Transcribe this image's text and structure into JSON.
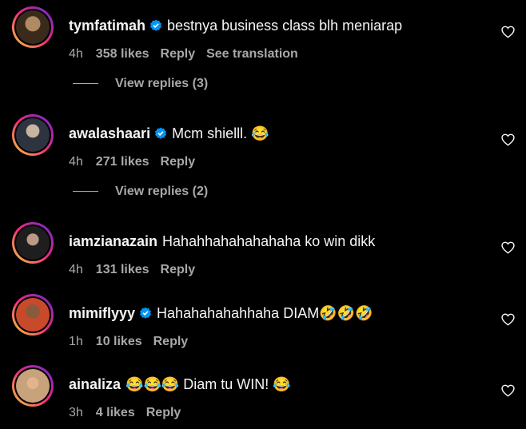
{
  "comments": [
    {
      "username": "tymfatimah",
      "verified": true,
      "text": "bestnya business class blh meniarap",
      "time": "4h",
      "likes": "358 likes",
      "reply": "Reply",
      "see_translation": "See translation",
      "view_replies": "View replies (3)",
      "avatar_color": "#7a5a3c"
    },
    {
      "username": "awalashaari",
      "verified": true,
      "text": "Mcm shielll. 😂",
      "time": "4h",
      "likes": "271 likes",
      "reply": "Reply",
      "view_replies": "View replies (2)",
      "avatar_color": "#6b7785"
    },
    {
      "username": "iamzianazain",
      "verified": false,
      "text": "Hahahhahahahahaha ko win dikk",
      "time": "4h",
      "likes": "131 likes",
      "reply": "Reply",
      "avatar_color": "#3a3a3a"
    },
    {
      "username": "mimiflyyy",
      "verified": true,
      "text": "Hahahahahahhaha DIAM🤣🤣🤣",
      "time": "1h",
      "likes": "10 likes",
      "reply": "Reply",
      "avatar_color": "#a65a3a"
    },
    {
      "username": "ainaliza",
      "verified": false,
      "text": "😂😂😂 Diam tu WIN! 😂",
      "time": "3h",
      "likes": "4 likes",
      "reply": "Reply",
      "avatar_color": "#d9b48a"
    }
  ],
  "colors": {
    "background": "#000000",
    "primary_text": "#f5f5f5",
    "secondary_text": "#a8a8a8",
    "verified_blue": "#0095f6"
  },
  "icons": {
    "verified": "verified-badge-icon",
    "like": "heart-outline-icon"
  }
}
